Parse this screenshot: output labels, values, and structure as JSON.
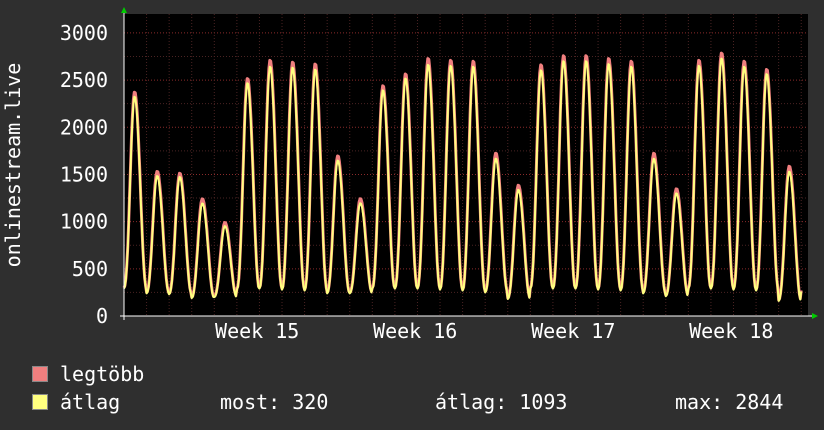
{
  "chart_data": {
    "type": "line",
    "title": "",
    "ylabel": "onlinestream.live",
    "xlabel": "",
    "ylim": [
      0,
      3200
    ],
    "y_ticks": [
      0,
      500,
      1000,
      1500,
      2000,
      2500,
      3000
    ],
    "x_ticks": [
      "Week 15",
      "Week 16",
      "Week 17",
      "Week 18"
    ],
    "grid": true,
    "legend_placement": "bottom-left",
    "series": [
      {
        "name": "legtöbb",
        "color": "#f07f7f",
        "daily_peaks": [
          2450,
          1580,
          1560,
          1280,
          1020,
          2600,
          2800,
          2780,
          2760,
          1750,
          1280,
          2520,
          2650,
          2820,
          2800,
          2790,
          1780,
          1430,
          2750,
          2850,
          2850,
          2820,
          2790,
          1780,
          1390,
          2800,
          2880,
          2790,
          2700,
          1640
        ],
        "daily_lows": [
          300,
          250,
          240,
          200,
          210,
          290,
          300,
          290,
          280,
          250,
          250,
          300,
          300,
          300,
          290,
          280,
          260,
          190,
          300,
          300,
          300,
          290,
          280,
          250,
          220,
          300,
          300,
          290,
          280,
          170
        ]
      },
      {
        "name": "átlag",
        "color": "#ffff80",
        "daily_peaks": [
          2400,
          1530,
          1520,
          1230,
          980,
          2550,
          2730,
          2720,
          2700,
          1700,
          1230,
          2470,
          2600,
          2750,
          2740,
          2730,
          1720,
          1380,
          2690,
          2790,
          2790,
          2760,
          2730,
          1720,
          1340,
          2740,
          2820,
          2730,
          2650,
          1580
        ],
        "daily_lows": [
          290,
          240,
          230,
          190,
          200,
          280,
          290,
          280,
          270,
          240,
          240,
          290,
          290,
          290,
          280,
          270,
          250,
          180,
          290,
          290,
          290,
          280,
          270,
          240,
          210,
          290,
          290,
          280,
          270,
          160
        ]
      }
    ]
  },
  "legend": {
    "max_label": "legtöbb",
    "avg_label": "átlag",
    "max_color": "#f07f7f",
    "avg_color": "#ffff80"
  },
  "stats": {
    "now": "most: 320",
    "avg": "átlag: 1093",
    "max": "max: 2844"
  }
}
